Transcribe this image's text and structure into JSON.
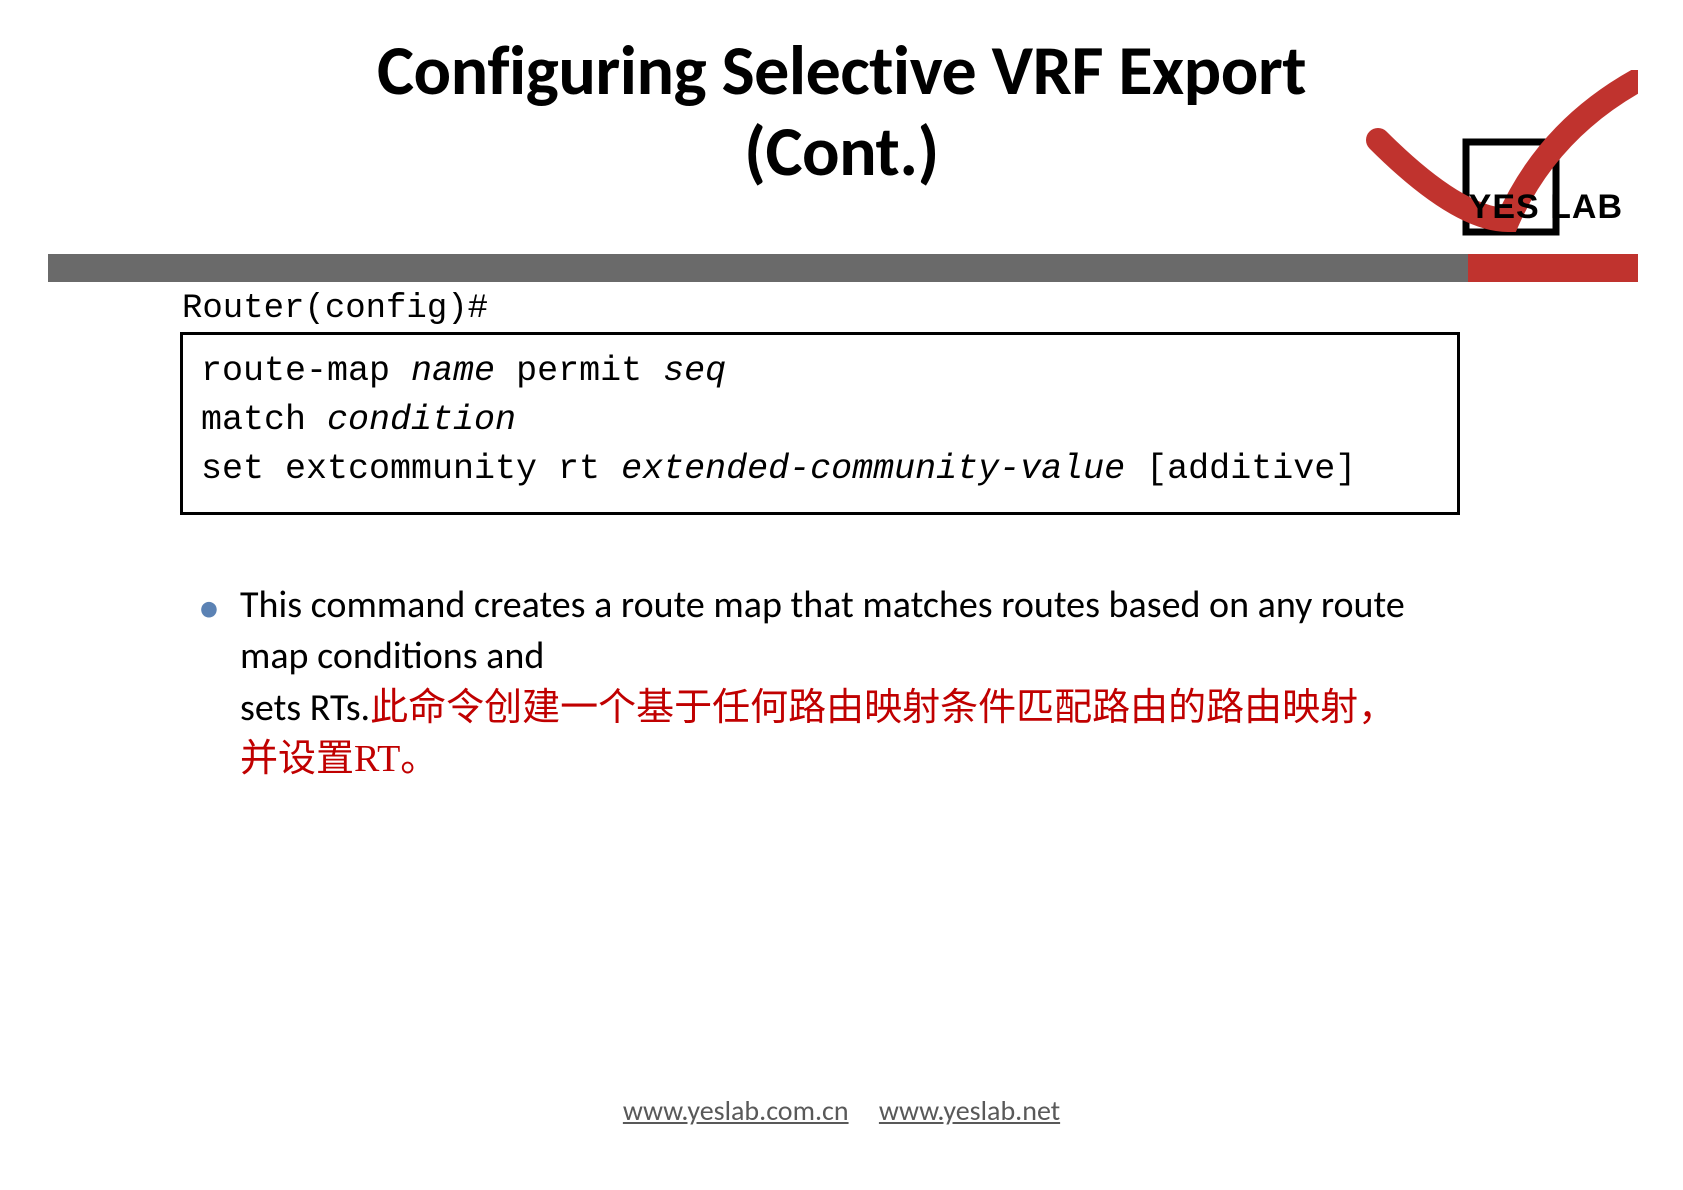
{
  "title": {
    "line1": "Configuring Selective VRF Export",
    "line2": "(Cont.)"
  },
  "logo": {
    "text": "YES LAB"
  },
  "prompt": "Router(config)#",
  "code": {
    "line1_a": "route-map ",
    "line1_b": "name",
    "line1_c": " permit ",
    "line1_d": "seq",
    "line2_a": " match ",
    "line2_b": "condition",
    "line3_a": " set extcommunity rt ",
    "line3_b": "extended-community-value",
    "line3_c": " [additive]"
  },
  "bullet": {
    "en_part1": "This command creates a route map that matches routes based on any route map conditions and",
    "en_part2": "sets RTs.",
    "cn_part1": "此命令创建一个基于任何路由映射条件匹配路由的路由映射，",
    "cn_part2": "并设置RT。"
  },
  "footer": {
    "link1": "www.yeslab.com.cn",
    "link2": "www.yeslab.net"
  }
}
